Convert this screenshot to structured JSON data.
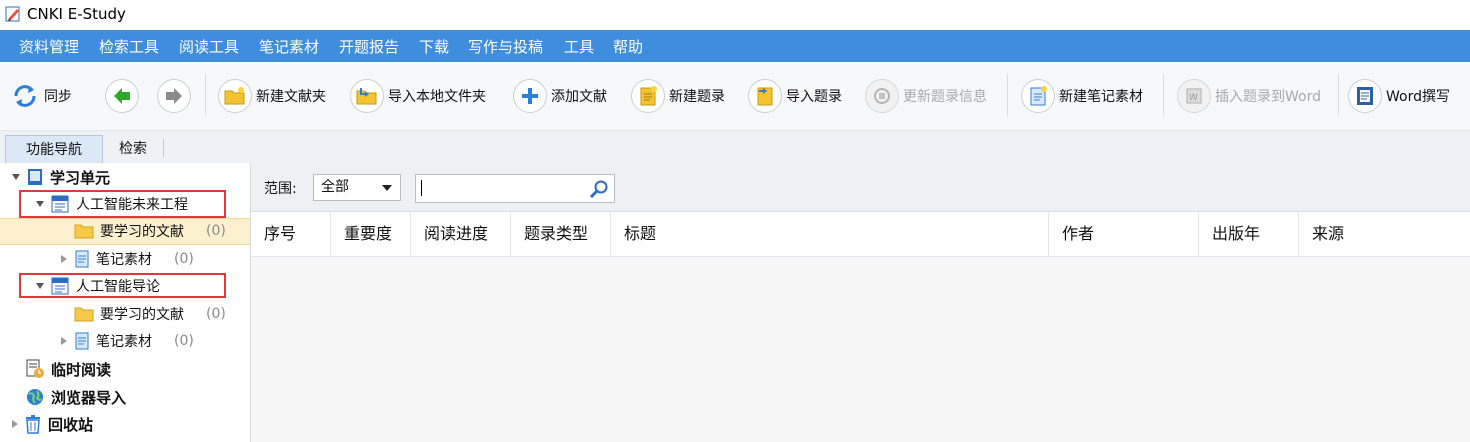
{
  "window": {
    "title": "CNKI E-Study",
    "icon": "pencil-note-icon"
  },
  "colors": {
    "menubar": "#3e8edd",
    "highlight": "#fdf0cf",
    "annotation_box": "#e0383c"
  },
  "menu": [
    "资料管理",
    "检索工具",
    "阅读工具",
    "笔记素材",
    "开题报告",
    "下载",
    "写作与投稿",
    "工具",
    "帮助"
  ],
  "toolbar": {
    "sync": "同步",
    "back_icon": "green-left-arrow-icon",
    "forward_icon": "gray-right-arrow-icon",
    "new_folder": "新建文献夹",
    "import_local_folder": "导入本地文件夹",
    "add_document": "添加文献",
    "new_record": "新建题录",
    "import_record": "导入题录",
    "update_record_info": "更新题录信息",
    "new_note_material": "新建笔记素材",
    "insert_record_word": "插入题录到Word",
    "word_writing": "Word撰写"
  },
  "tabs": [
    "功能导航",
    "检索"
  ],
  "tree": {
    "study_unit": "学习单元",
    "project1": {
      "label": "人工智能未来工程",
      "docs": "要学习的文献",
      "docs_count": "(0)",
      "notes": "笔记素材",
      "notes_count": "(0)"
    },
    "project2": {
      "label": "人工智能导论",
      "docs": "要学习的文献",
      "docs_count": "(0)",
      "notes": "笔记素材",
      "notes_count": "(0)"
    },
    "temp_reading": "临时阅读",
    "browser_import": "浏览器导入",
    "recycle_bin": "回收站"
  },
  "filter": {
    "scope_label": "范围:",
    "scope_value": "全部",
    "search_value": ""
  },
  "columns": [
    "序号",
    "重要度",
    "阅读进度",
    "题录类型",
    "标题",
    "作者",
    "出版年",
    "来源"
  ]
}
